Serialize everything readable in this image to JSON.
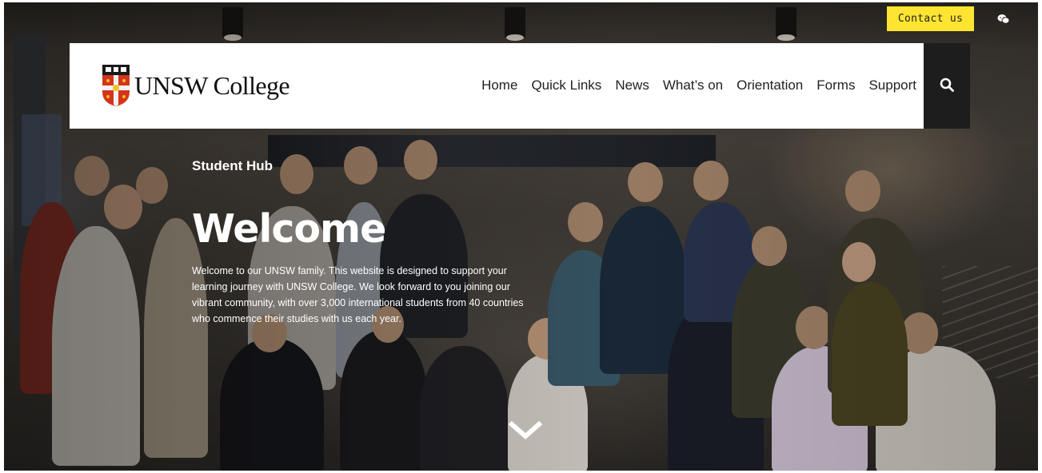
{
  "topbar": {
    "contact_label": "Contact us",
    "chat_icon": "wechat-icon"
  },
  "brand": {
    "logo_text": "UNSW College",
    "crest_icon": "unsw-crest-icon"
  },
  "nav": {
    "items": [
      {
        "label": "Home"
      },
      {
        "label": "Quick Links"
      },
      {
        "label": "News"
      },
      {
        "label": "What’s on"
      },
      {
        "label": "Orientation"
      },
      {
        "label": "Forms"
      },
      {
        "label": "Support"
      }
    ],
    "search_icon": "search-icon"
  },
  "hero": {
    "eyebrow": "Student Hub",
    "title": "Welcome",
    "body": "Welcome to our UNSW family. This website is designed to support your learning journey with UNSW College. We look forward to you joining our vibrant community, with over 3,000 international students from 40 countries who commence their studies with us each year.",
    "scroll_icon": "chevron-down-icon"
  },
  "colors": {
    "accent_yellow": "#ffe431",
    "search_bg": "#1d1d1d",
    "crest_red": "#d4351c"
  }
}
